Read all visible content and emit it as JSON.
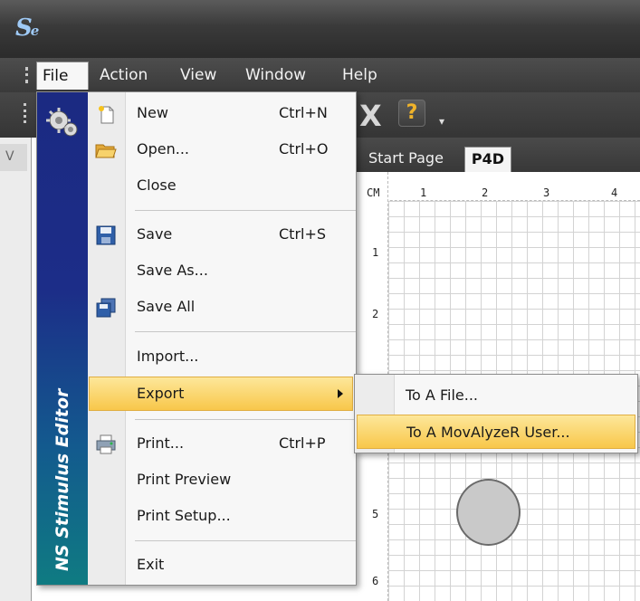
{
  "app": {
    "logo_main": "S",
    "logo_sub": "e"
  },
  "menubar": {
    "items": [
      "File",
      "Action",
      "View",
      "Window",
      "Help"
    ]
  },
  "toolbar": {
    "close_icon": "X",
    "help_icon": "?"
  },
  "document": {
    "tabs": [
      "Start Page",
      "P4D"
    ],
    "active_tab": "P4D",
    "ruler_unit": "CM",
    "ruler_x": [
      "1",
      "2",
      "3",
      "4"
    ],
    "ruler_y": [
      "1",
      "2",
      "5",
      "6"
    ]
  },
  "file_menu": {
    "banner": "NS Stimulus Editor",
    "items": [
      {
        "label": "New",
        "shortcut": "Ctrl+N",
        "icon": "new-file-icon"
      },
      {
        "label": "Open...",
        "shortcut": "Ctrl+O",
        "icon": "open-folder-icon"
      },
      {
        "label": "Close",
        "shortcut": ""
      },
      {
        "label": "Save",
        "shortcut": "Ctrl+S",
        "icon": "save-disk-icon"
      },
      {
        "label": "Save As...",
        "shortcut": ""
      },
      {
        "label": "Save All",
        "shortcut": "",
        "icon": "save-all-icon"
      },
      {
        "label": "Import...",
        "shortcut": ""
      },
      {
        "label": "Export",
        "shortcut": "",
        "highlighted": true
      },
      {
        "label": "Print...",
        "shortcut": "Ctrl+P",
        "icon": "printer-icon"
      },
      {
        "label": "Print Preview",
        "shortcut": ""
      },
      {
        "label": "Print Setup...",
        "shortcut": ""
      },
      {
        "label": "Exit",
        "shortcut": ""
      }
    ]
  },
  "export_submenu": {
    "items": [
      {
        "label": "To A File..."
      },
      {
        "label": "To A MovAlyzeR User...",
        "highlighted": true
      }
    ]
  },
  "colors": {
    "highlight": "#f8c74a",
    "banner_top": "#1b2a82",
    "banner_bottom": "#0f7b82",
    "title_bar": "#3a3a3a"
  }
}
